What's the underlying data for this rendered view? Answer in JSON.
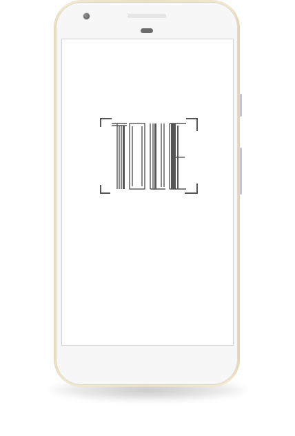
{
  "device": {
    "model": "smartphone",
    "frame_color": "#eadfc3",
    "screen_background": "#ffffff"
  },
  "screen": {
    "logo": {
      "brand_text": "TOLLE",
      "icon": "barcode-logo-icon",
      "color": "#555555"
    }
  }
}
